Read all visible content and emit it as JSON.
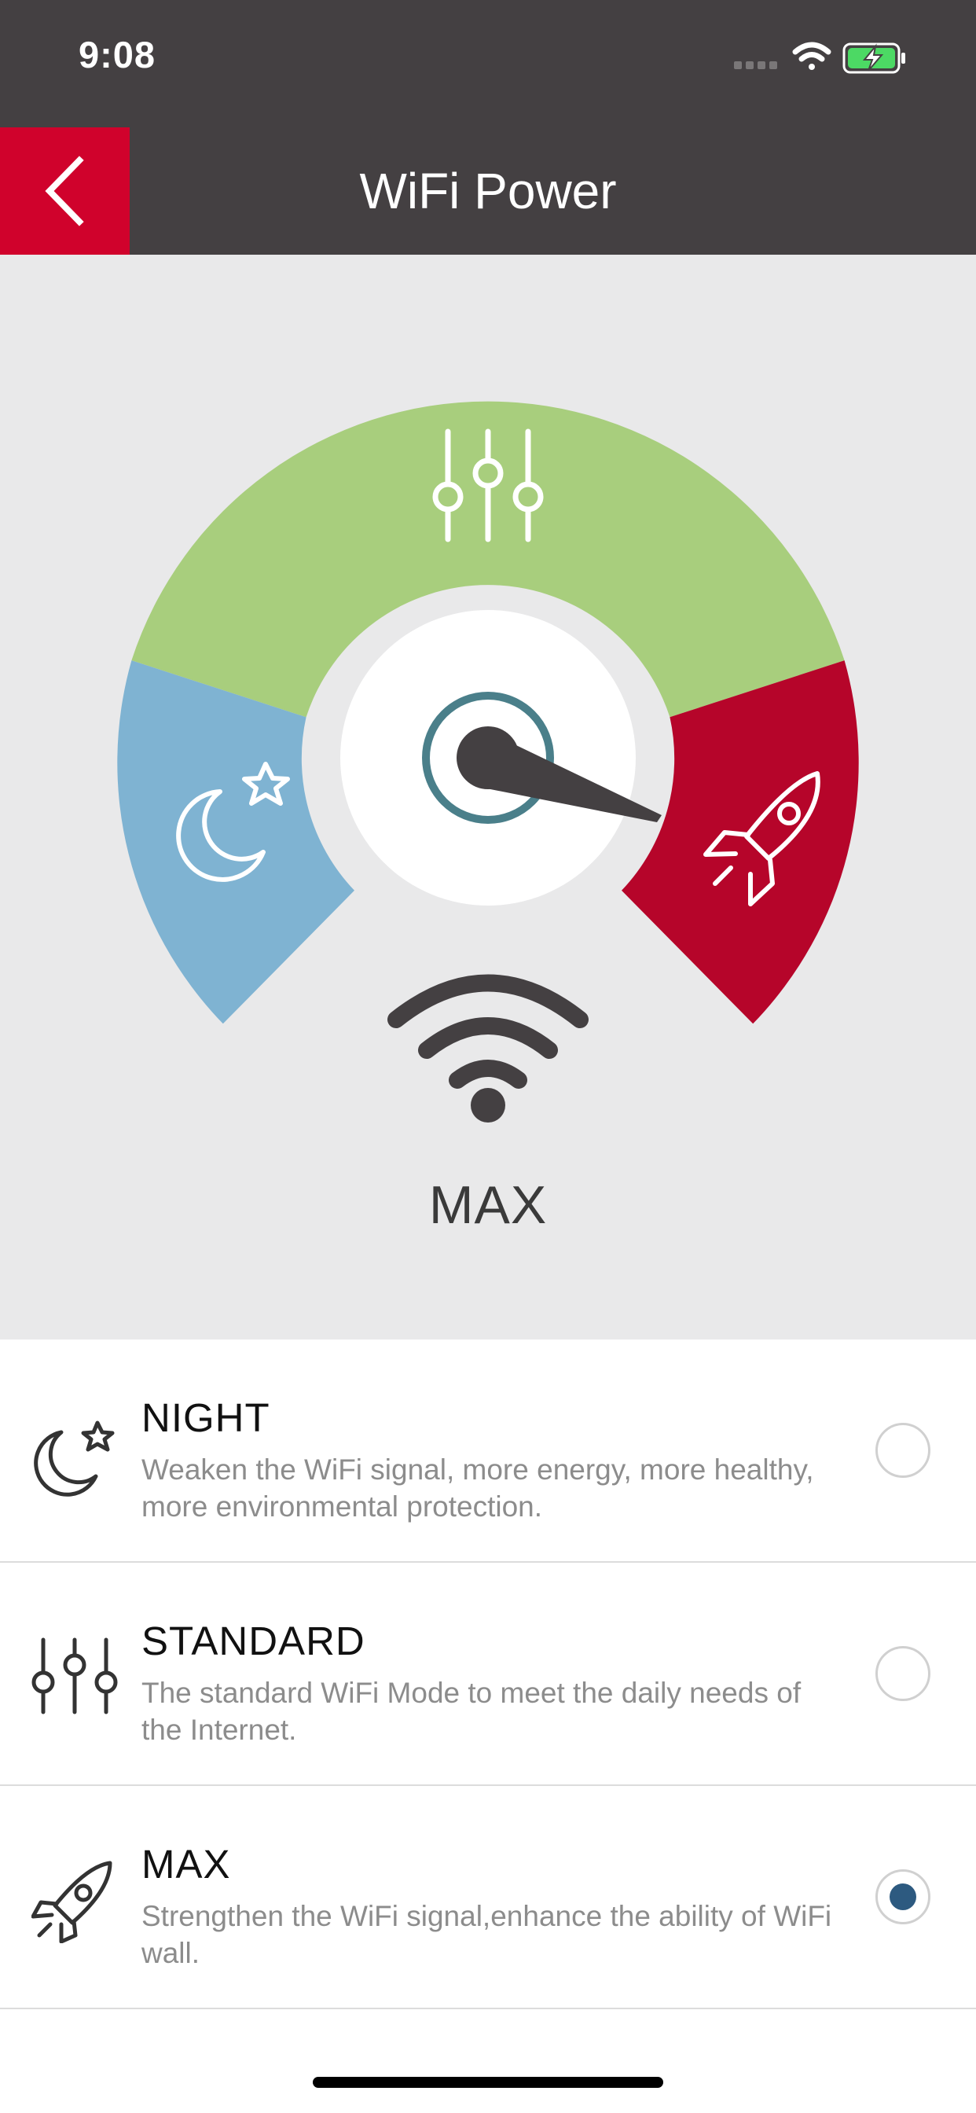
{
  "status_bar": {
    "time": "9:08"
  },
  "nav": {
    "title": "WiFi Power"
  },
  "gauge": {
    "current_mode": "MAX",
    "segments": [
      {
        "name": "night",
        "color": "#7fb3d2",
        "icon": "moon-star-icon"
      },
      {
        "name": "standard",
        "color": "#a8ce7d",
        "icon": "sliders-icon"
      },
      {
        "name": "max",
        "color": "#b6052a",
        "icon": "rocket-icon"
      }
    ],
    "needle_color": "#444042",
    "ring_color": "#4a7f8a"
  },
  "options": [
    {
      "title": "NIGHT",
      "description": "Weaken the WiFi signal, more energy, more healthy, more environmental protection.",
      "icon": "moon-star-icon",
      "selected": false
    },
    {
      "title": "STANDARD",
      "description": "The standard WiFi Mode to meet the daily needs of the Internet.",
      "icon": "sliders-icon",
      "selected": false
    },
    {
      "title": "MAX",
      "description": "Strengthen the WiFi signal,enhance the ability of WiFi wall.",
      "icon": "rocket-icon",
      "selected": true
    }
  ],
  "colors": {
    "header_bg": "#444042",
    "accent_red": "#d0022c",
    "radio_selected": "#2d5a80"
  }
}
